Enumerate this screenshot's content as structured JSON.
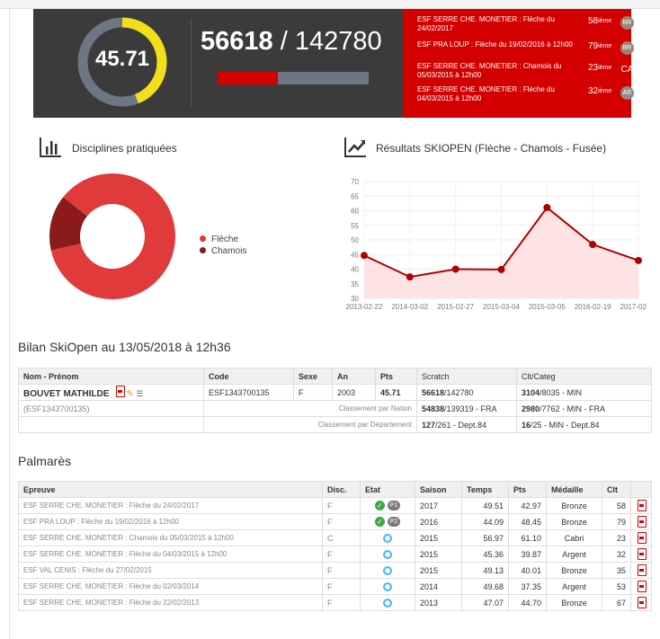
{
  "header": {
    "gauge": {
      "value_text": "45.71",
      "fill_fraction": 0.44
    },
    "scratch": {
      "rank": "56618",
      "separator": " / ",
      "total": "142780",
      "fill_fraction": 0.4
    },
    "recent_results": [
      {
        "text": "ESF SERRE CHE. MONETIER : Flèche du 24/02/2017",
        "rank": "58",
        "suffix": "ième",
        "badge": "BR",
        "badge_style": "bronze"
      },
      {
        "text": "ESF PRA LOUP : Flèche du 19/02/2016 à 12h00",
        "rank": "79",
        "suffix": "ième",
        "badge": "BR",
        "badge_style": "bronze"
      },
      {
        "text": "ESF SERRE CHE. MONETIER : Chamois du 05/03/2015 à 12h00",
        "rank": "23",
        "suffix": "ième",
        "badge": "CA",
        "badge_style": "plain"
      },
      {
        "text": "ESF SERRE CHE. MONETIER : Flèche du 04/03/2015 à 12h00",
        "rank": "32",
        "suffix": "ième",
        "badge": "AR",
        "badge_style": "gray"
      }
    ]
  },
  "disciplines": {
    "title": "Disciplines pratiquées",
    "icon": "bar-chart-icon",
    "legend": [
      {
        "label": "Flèche",
        "color": "#e03a3a"
      },
      {
        "label": "Chamois",
        "color": "#8b1a1a"
      }
    ]
  },
  "results_chart_title": "Résultats SKIOPEN (Flèche - Chamois - Fusée)",
  "chart_data": [
    {
      "type": "pie",
      "labels": [
        "Flèche",
        "Chamois"
      ],
      "values": [
        6,
        1
      ],
      "colors": [
        "#e03a3a",
        "#8b1a1a"
      ]
    },
    {
      "type": "area",
      "x": [
        "2013-02-22",
        "2014-03-02",
        "2015-02-27",
        "2015-03-04",
        "2015-03-05",
        "2016-02-19",
        "2017-02-24"
      ],
      "series": [
        {
          "values": [
            44.7,
            37.35,
            40.01,
            39.87,
            61.1,
            48.45,
            42.97
          ]
        }
      ],
      "yticks": [
        30,
        35,
        40,
        45,
        50,
        55,
        60,
        65,
        70
      ],
      "ylim": [
        30,
        70
      ],
      "grid": true,
      "line_color": "#b00000",
      "fill_color": "#fde3e3"
    }
  ],
  "bilan": {
    "title": "Bilan SkiOpen au 13/05/2018 à 12h36",
    "headers": [
      "Nom - Prénom",
      "Code",
      "Sexe",
      "An",
      "Pts",
      "Scratch",
      "Clt/Categ"
    ],
    "name": "BOUVET MATHILDE",
    "code": "ESF1343700135",
    "sexe": "F",
    "an": "2003",
    "pts": "45.71",
    "scratch_rank": "56618",
    "scratch_total": "/142780",
    "categ_rank": "3104",
    "categ_rest": "/8035 - MIN",
    "code_paren": "(ESF1343700135)",
    "nation_label": "Classement par Nation",
    "nation_rank": "54838",
    "nation_rest": "/139319 - FRA",
    "nation_categ_rank": "2980",
    "nation_categ_rest": "/7762 - MIN - FRA",
    "dept_label": "Classement par Département",
    "dept_rank": "127",
    "dept_rest": "/261 - Dept.84",
    "dept_categ_rank": "16",
    "dept_categ_rest": "/25 - MIN - Dept.84"
  },
  "palmares": {
    "title": "Palmarès",
    "headers": [
      "Epreuve",
      "Disc.",
      "Etat",
      "Saison",
      "Temps",
      "Pts",
      "Médaille",
      "Clt"
    ],
    "rows": [
      {
        "epreuve": "ESF SERRE CHE. MONETIER : Flèche du 24/02/2017",
        "disc": "F",
        "etat": "check",
        "pill": "P1",
        "saison": "2017",
        "temps": "49.51",
        "pts": "42.97",
        "medaille": "Bronze",
        "clt": "58"
      },
      {
        "epreuve": "ESF PRA LOUP : Flèche du 19/02/2016 à 12h00",
        "disc": "F",
        "etat": "check",
        "pill": "P2",
        "saison": "2016",
        "temps": "44.09",
        "pts": "48.45",
        "medaille": "Bronze",
        "clt": "79"
      },
      {
        "epreuve": "ESF SERRE CHE. MONETIER : Chamois du 05/03/2015 à 12h00",
        "disc": "C",
        "etat": "ring",
        "pill": "",
        "saison": "2015",
        "temps": "56.97",
        "pts": "61.10",
        "medaille": "Cabri",
        "clt": "23"
      },
      {
        "epreuve": "ESF SERRE CHE. MONETIER : Flèche du 04/03/2015 à 12h00",
        "disc": "F",
        "etat": "ring",
        "pill": "",
        "saison": "2015",
        "temps": "45.36",
        "pts": "39.87",
        "medaille": "Argent",
        "clt": "32"
      },
      {
        "epreuve": "ESF VAL CENIS : Flèche du 27/02/2015",
        "disc": "F",
        "etat": "ring",
        "pill": "",
        "saison": "2015",
        "temps": "49.13",
        "pts": "40.01",
        "medaille": "Bronze",
        "clt": "35"
      },
      {
        "epreuve": "ESF SERRE CHE. MONETIER : Flèche du 02/03/2014",
        "disc": "F",
        "etat": "ring",
        "pill": "",
        "saison": "2014",
        "temps": "49.68",
        "pts": "37.35",
        "medaille": "Argent",
        "clt": "53"
      },
      {
        "epreuve": "ESF SERRE CHE. MONETIER : Flèche du 22/02/2013",
        "disc": "F",
        "etat": "ring",
        "pill": "",
        "saison": "2013",
        "temps": "47.07",
        "pts": "44.70",
        "medaille": "Bronze",
        "clt": "67"
      }
    ]
  },
  "colors": {
    "accent_red": "#d40000",
    "banner_dark": "#3b3b3b",
    "gauge_yellow": "#f2de1b",
    "gauge_track": "#6e7686"
  }
}
